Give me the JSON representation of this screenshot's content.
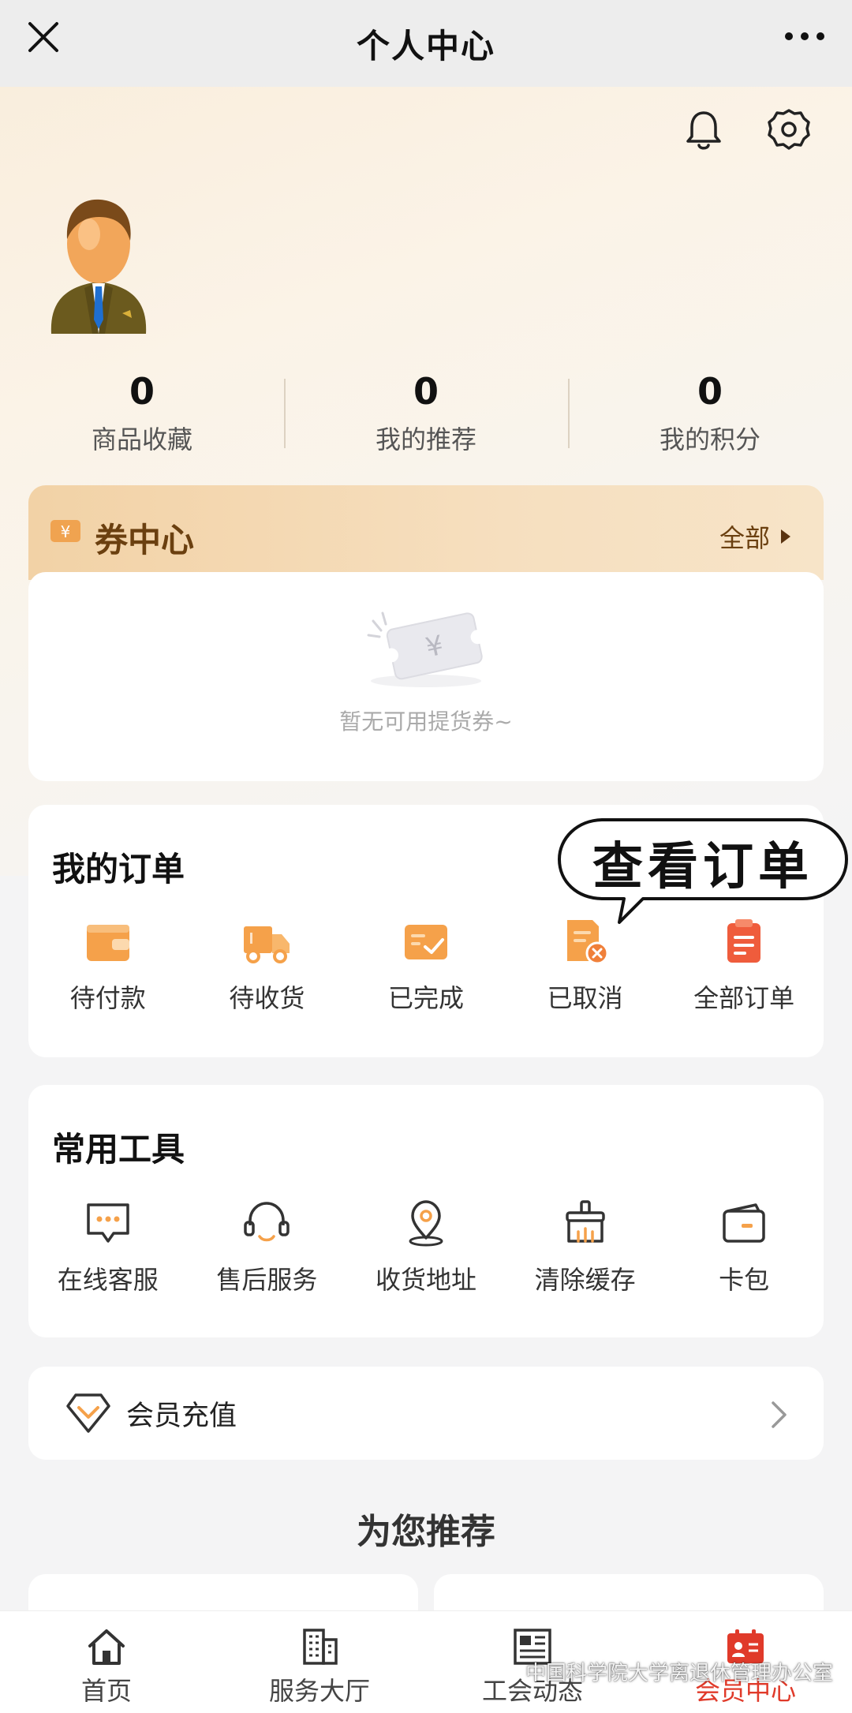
{
  "header": {
    "title": "个人中心"
  },
  "stats": [
    {
      "value": "0",
      "label": "商品收藏"
    },
    {
      "value": "0",
      "label": "我的推荐"
    },
    {
      "value": "0",
      "label": "我的积分"
    }
  ],
  "coupon_center": {
    "title": "券中心",
    "all_label": "全部",
    "empty_text": "暂无可用提货券~"
  },
  "orders": {
    "title": "我的订单",
    "callout": "查看订单",
    "items": [
      {
        "label": "待付款",
        "icon": "wallet-icon"
      },
      {
        "label": "待收货",
        "icon": "truck-icon"
      },
      {
        "label": "已完成",
        "icon": "completed-icon"
      },
      {
        "label": "已取消",
        "icon": "cancelled-icon"
      },
      {
        "label": "全部订单",
        "icon": "clipboard-icon"
      }
    ]
  },
  "tools": {
    "title": "常用工具",
    "items": [
      {
        "label": "在线客服",
        "icon": "chat-icon"
      },
      {
        "label": "售后服务",
        "icon": "headset-icon"
      },
      {
        "label": "收货地址",
        "icon": "location-icon"
      },
      {
        "label": "清除缓存",
        "icon": "broom-icon"
      },
      {
        "label": "卡包",
        "icon": "card-icon"
      }
    ]
  },
  "membership": {
    "label": "会员充值"
  },
  "recommend": {
    "title": "为您推荐"
  },
  "tabbar": [
    {
      "label": "首页",
      "icon": "home-icon",
      "active": false
    },
    {
      "label": "服务大厅",
      "icon": "building-icon",
      "active": false
    },
    {
      "label": "工会动态",
      "icon": "news-icon",
      "active": false
    },
    {
      "label": "会员中心",
      "icon": "member-card-icon",
      "active": true
    }
  ],
  "watermark": "中国科学院大学离退休管理办公室",
  "colors": {
    "accent_orange": "#f5a24a",
    "active_tab": "#e03a2a",
    "coupon_header": "#f3d5ab",
    "brown_text": "#6b4010"
  }
}
